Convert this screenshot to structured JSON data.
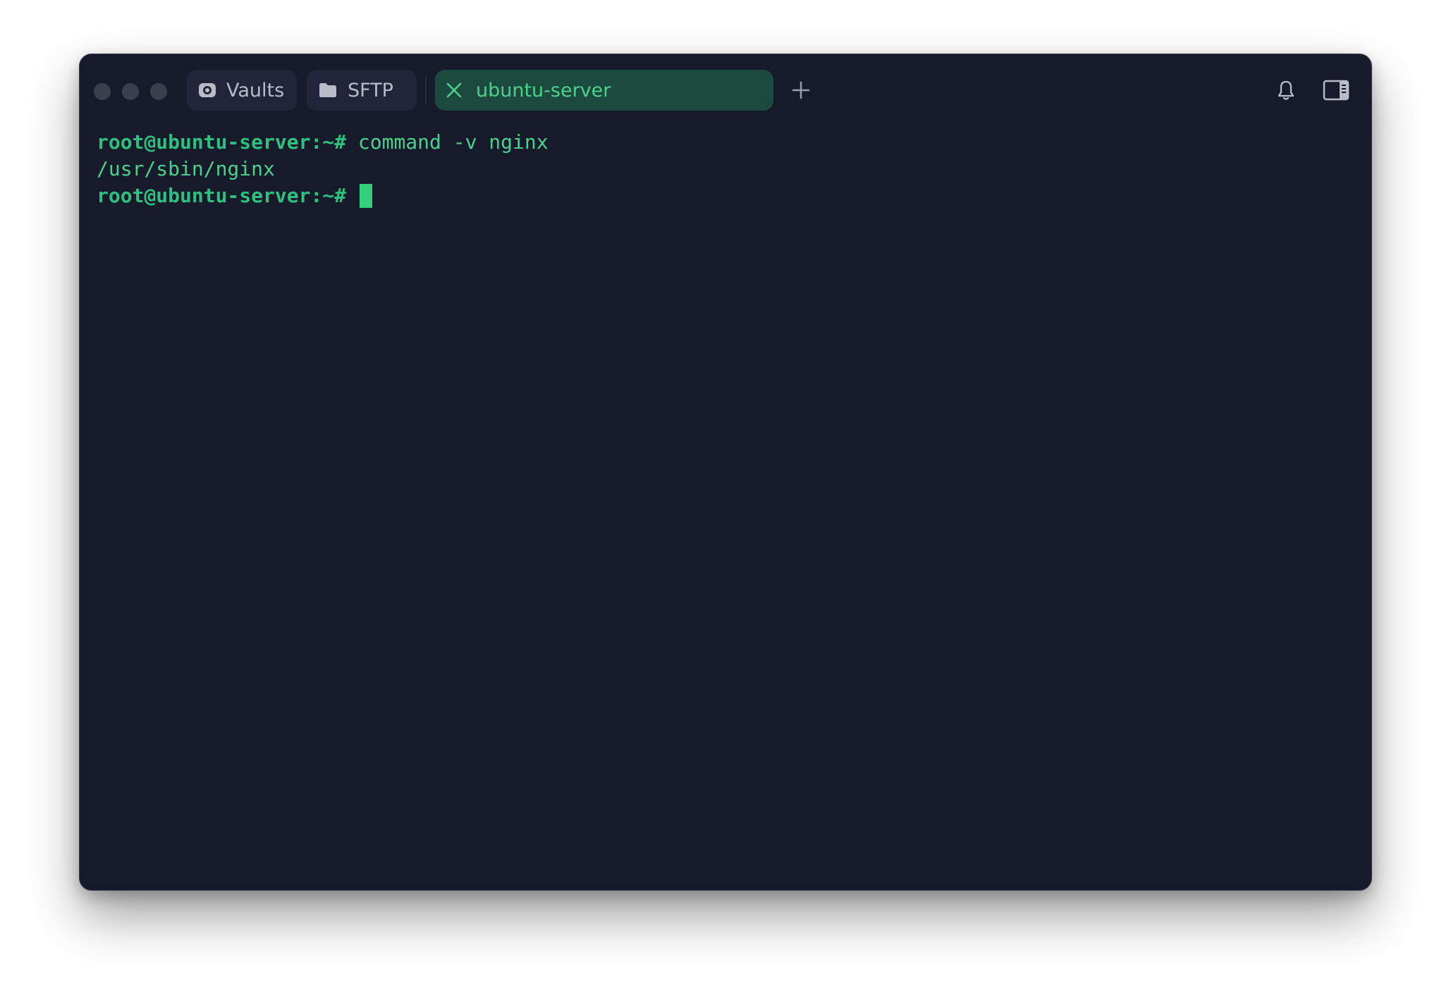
{
  "tabs": [
    {
      "label": "Vaults",
      "icon": "vault-icon"
    },
    {
      "label": "SFTP",
      "icon": "folder-icon"
    },
    {
      "label": "ubuntu-server",
      "icon": "close-icon",
      "active": true
    }
  ],
  "toolbar": {
    "new_tab_icon": "plus-icon",
    "notifications_icon": "bell-icon",
    "sidebar_icon": "sidebar-toggle-icon"
  },
  "terminal": {
    "lines": [
      {
        "prompt": "root@ubuntu-server:~#",
        "command": " command -v nginx"
      },
      {
        "output": "/usr/sbin/nginx"
      },
      {
        "prompt": "root@ubuntu-server:~#",
        "command": " "
      }
    ]
  },
  "colors": {
    "background": "#171a2b",
    "accent": "#4cd18d",
    "active_tab": "#1d4a3f",
    "cursor": "#33d17a"
  }
}
